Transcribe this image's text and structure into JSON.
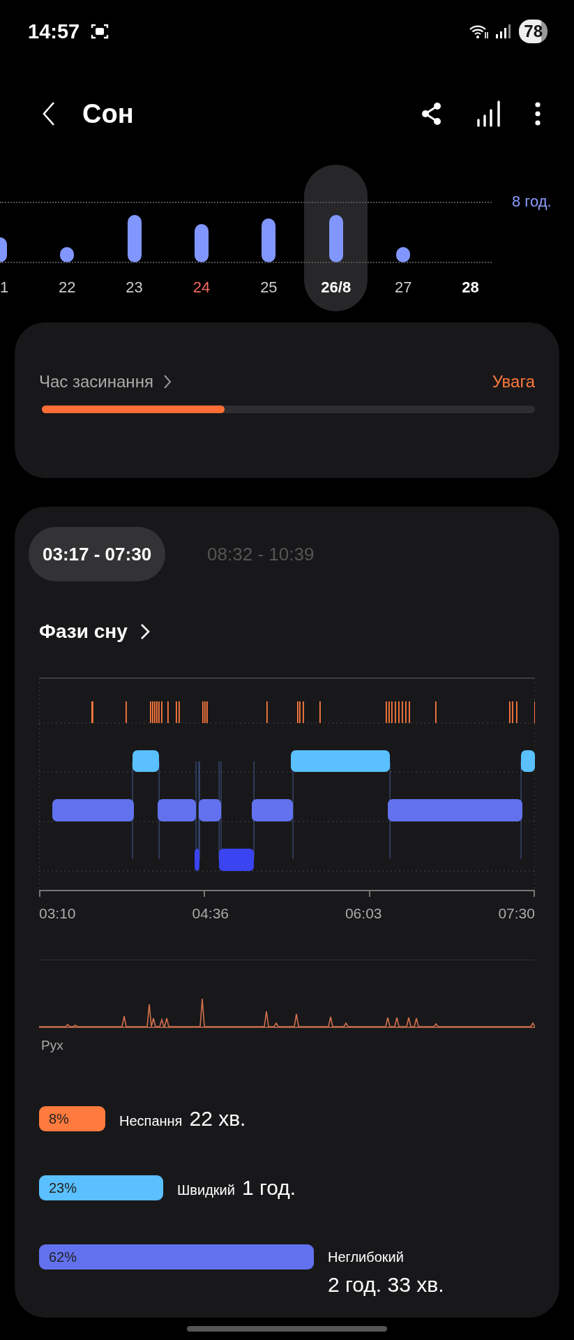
{
  "status_bar": {
    "time": "14:57",
    "battery": "78"
  },
  "header": {
    "title": "Сон"
  },
  "days": {
    "goal_label": "8 год.",
    "items": [
      {
        "label": "1",
        "selected": false,
        "kind": "normal"
      },
      {
        "label": "22",
        "selected": false,
        "kind": "normal"
      },
      {
        "label": "23",
        "selected": false,
        "kind": "normal"
      },
      {
        "label": "24",
        "selected": false,
        "kind": "holiday"
      },
      {
        "label": "25",
        "selected": false,
        "kind": "normal"
      },
      {
        "label": "26/8",
        "selected": true,
        "kind": "normal"
      },
      {
        "label": "27",
        "selected": false,
        "kind": "normal"
      },
      {
        "label": "28",
        "selected": false,
        "kind": "today"
      }
    ]
  },
  "bedtime_card": {
    "title": "Час засинання",
    "status": "Увага",
    "level": 0.37
  },
  "sessions": [
    {
      "label": "03:17 - 07:30",
      "selected": true
    },
    {
      "label": "08:32 - 10:39",
      "selected": false
    }
  ],
  "stages": {
    "title": "Фази сну",
    "time_labels": [
      "03:10",
      "04:36",
      "06:03",
      "07:30"
    ],
    "movement_label": "Рух"
  },
  "legend": [
    {
      "percent": "8%",
      "name": "Неспання",
      "duration": "22 хв.",
      "color": "#ff7a3d"
    },
    {
      "percent": "23%",
      "name": "Швидкий",
      "duration": "1 год.",
      "color": "#5ac0ff"
    },
    {
      "percent": "62%",
      "name": "Неглибокий",
      "duration": "2 год. 33 хв.",
      "color": "#6272ee"
    }
  ]
}
